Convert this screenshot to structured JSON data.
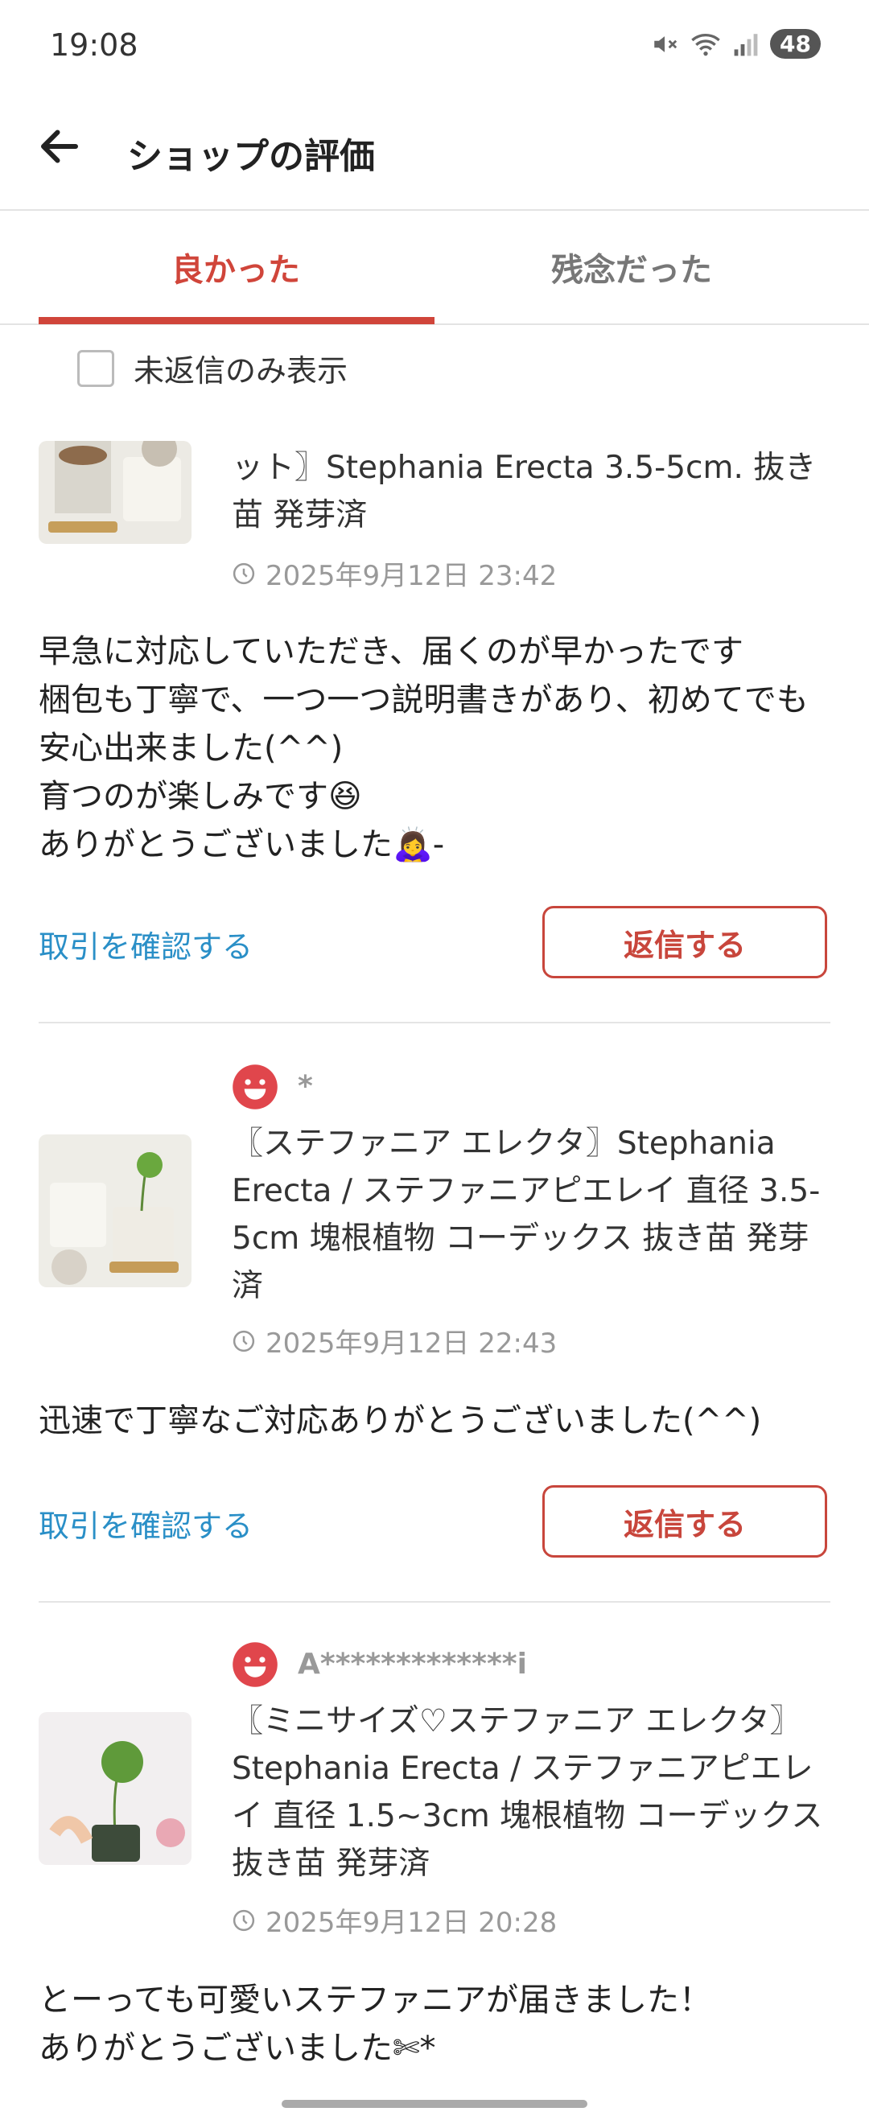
{
  "status_bar": {
    "time": "19:08",
    "battery": "48"
  },
  "header": {
    "title": "ショップの評価"
  },
  "tabs": [
    {
      "label": "良かった"
    },
    {
      "label": "残念だった"
    }
  ],
  "filter": {
    "label": "未返信のみ表示"
  },
  "reviews": [
    {
      "user": "",
      "product": "ット〗Stephania Erecta 3.5-5cm. 抜き苗 発芽済",
      "date": "2025年9月12日 23:42",
      "comment": "早急に対応していただき、届くのが早かったです\n梱包も丁寧で、一つ一つ説明書きがあり、初めてでも安心出来ました(^^)\n育つのが楽しみです😆\nありがとうございました🙇‍♀️-",
      "link": "取引を確認する",
      "reply": "返信する"
    },
    {
      "user": "*",
      "product": "〖ステファニア エレクタ〗Stephania Erecta / ステファニアピエレイ 直径 3.5-5cm 塊根植物 コーデックス 抜き苗 発芽済",
      "date": "2025年9月12日 22:43",
      "comment": "迅速で丁寧なご対応ありがとうございました(^^)",
      "link": "取引を確認する",
      "reply": "返信する"
    },
    {
      "user": "A*************i",
      "product": "〖ミニサイズ♡ステファニア エレクタ〗Stephania Erecta / ステファニアピエレイ 直径 1.5~3cm 塊根植物 コーデックス 抜き苗 発芽済",
      "date": "2025年9月12日 20:28",
      "comment": "とーっても可愛いステファニアが届きました！\nありがとうございました✄*",
      "link": "",
      "reply": ""
    }
  ],
  "colors": {
    "accent": "#d0453a",
    "link": "#2a8fc7"
  }
}
